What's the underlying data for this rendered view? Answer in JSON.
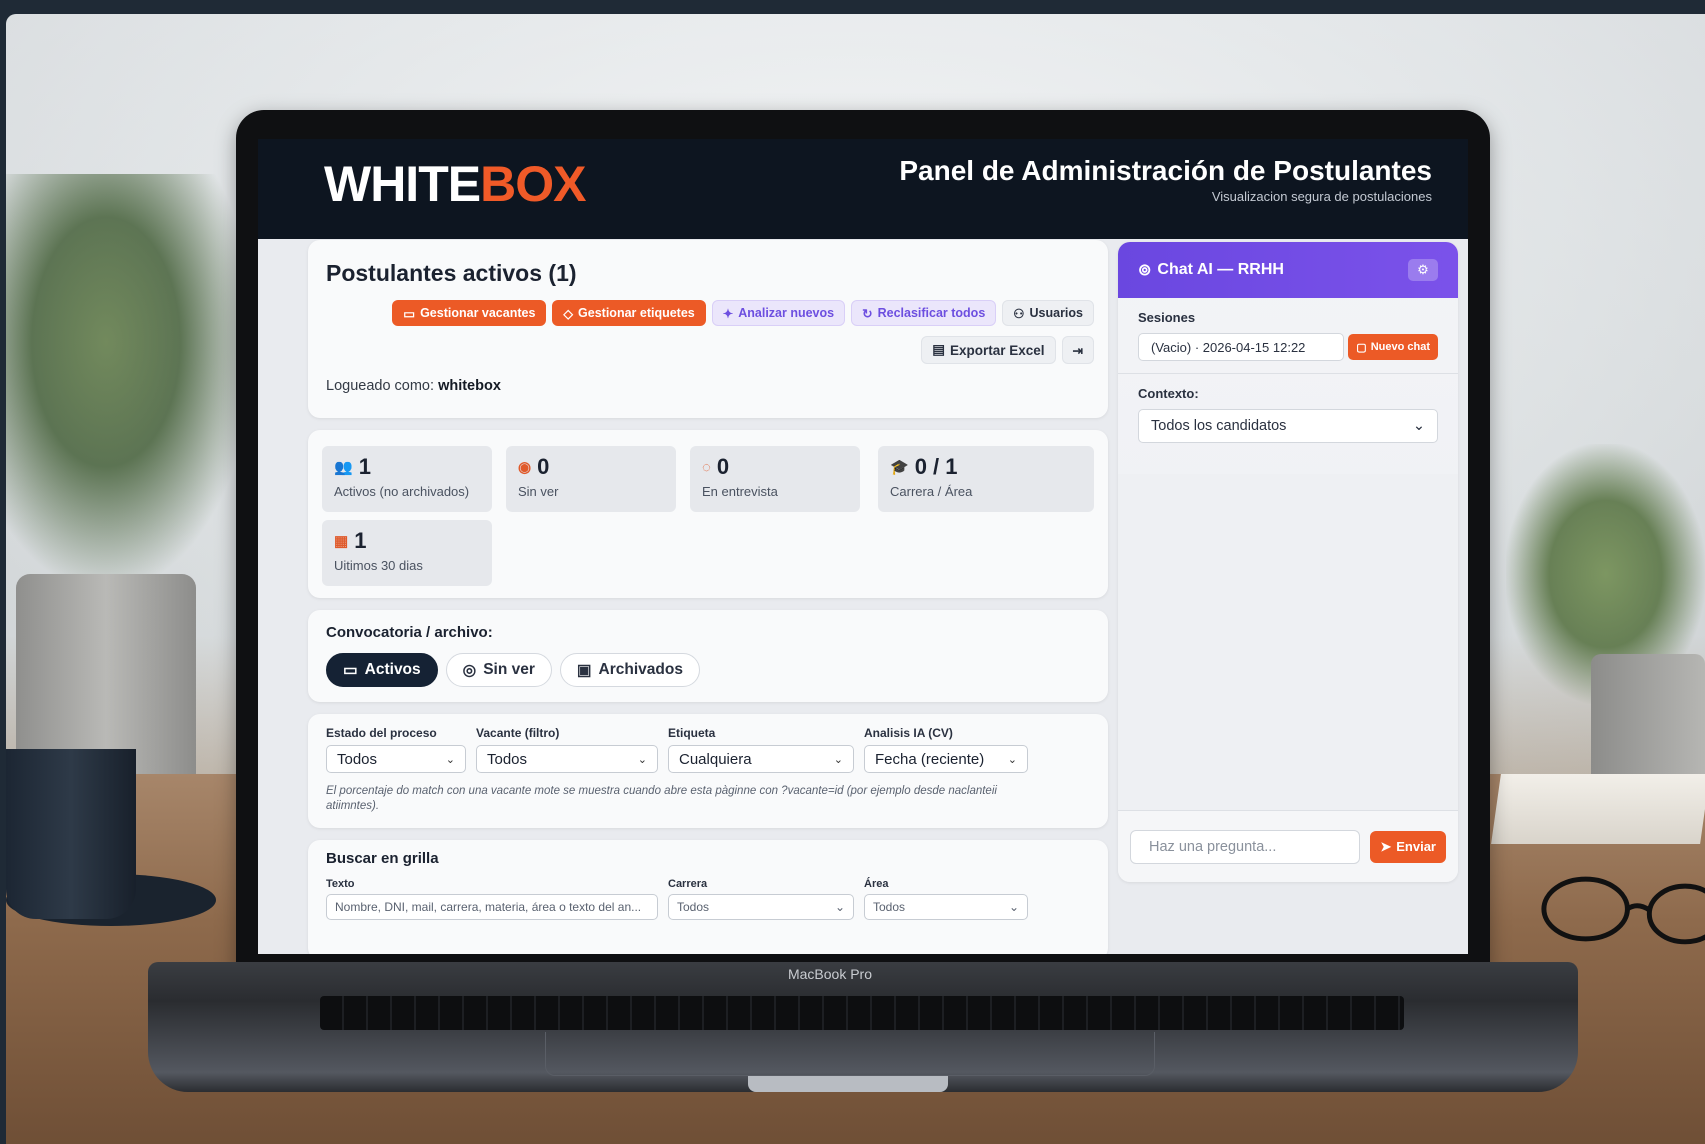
{
  "device": {
    "label": "MacBook Pro"
  },
  "header": {
    "logo_main": "WHITE",
    "logo_accent": "BOX",
    "title": "Panel de Administración de Postulantes",
    "subtitle": "Visualizacion segura de postulaciones"
  },
  "top": {
    "title": "Postulantes activos (1)",
    "buttons": {
      "vacantes": "Gestionar vacantes",
      "etiquetas": "Gestionar etiquetes",
      "analizar": "Analizar nuevos",
      "reclasificar": "Reclasificar todos",
      "usuarios": "Usuarios",
      "exportar": "Exportar Excel"
    },
    "logged_label": "Logueado como:",
    "logged_user": "whitebox"
  },
  "stats": [
    {
      "value": "1",
      "label": "Activos (no archivados)",
      "icon": "users-icon"
    },
    {
      "value": "0",
      "label": "Sin ver",
      "icon": "eye-off-icon"
    },
    {
      "value": "0",
      "label": "En entrevista",
      "icon": "chat-bubble-icon"
    },
    {
      "value": "0 / 1",
      "label": "Carrera / Área",
      "icon": "graduation-cap-icon"
    },
    {
      "value": "1",
      "label": "Uitimos 30 dias",
      "icon": "calendar-icon"
    }
  ],
  "convocatoria": {
    "title": "Convocatoria / archivo:",
    "tabs": [
      "Activos",
      "Sin ver",
      "Archivados"
    ],
    "active_tab": "Activos"
  },
  "filters": {
    "estado": {
      "label": "Estado del proceso",
      "value": "Todos"
    },
    "vacante": {
      "label": "Vacante (filtro)",
      "value": "Todos"
    },
    "etiqueta": {
      "label": "Etiqueta",
      "value": "Cualquiera"
    },
    "analisis": {
      "label": "Analisis IA (CV)",
      "value": "Fecha (reciente)"
    },
    "note": "El porcentaje do match con una vacante mote se muestra cuando abre esta pàginne con ?vacante=id (por ejemplo desde naclanteii atiimntes)."
  },
  "search": {
    "title": "Buscar en grilla",
    "texto": {
      "label": "Texto",
      "placeholder": "Nombre, DNI, mail, carrera, materia, área o texto del an..."
    },
    "carrera": {
      "label": "Carrera",
      "value": "Todos"
    },
    "area": {
      "label": "Área",
      "value": "Todos"
    }
  },
  "chat": {
    "title": "Chat AI — RRHH",
    "sessions_label": "Sesiones",
    "session_value": "(Vacio) · 2026-04-15 12:22",
    "new_chat": "Nuevo chat",
    "context_label": "Contexto:",
    "context_value": "Todos los candidatos",
    "input_placeholder": "Haz una pregunta...",
    "send": "Enviar"
  },
  "colors": {
    "accent": "#ec5a26",
    "chat_header": "#6a47e0",
    "header_bg": "#0d1520"
  }
}
